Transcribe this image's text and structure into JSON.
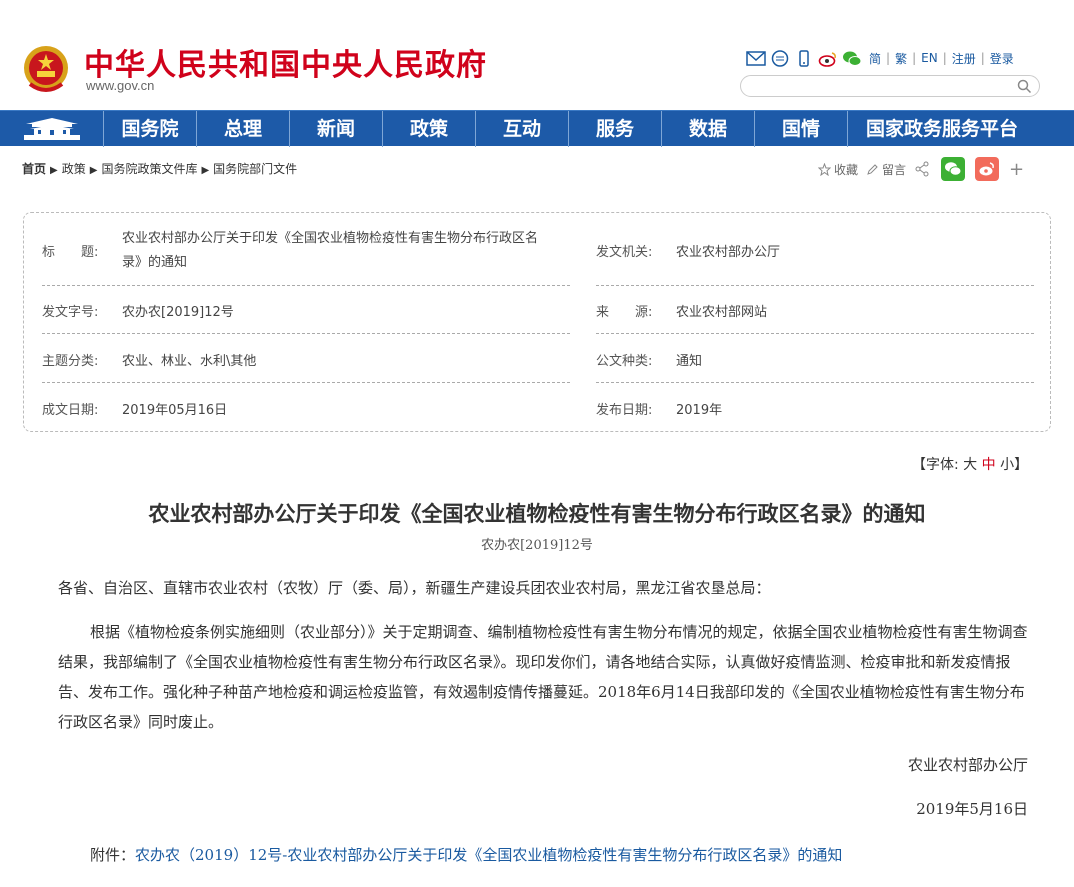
{
  "header": {
    "site_title": "中华人民共和国中央人民政府",
    "site_url": "www.gov.cn",
    "links": [
      "简",
      "繁",
      "EN",
      "注册",
      "登录"
    ],
    "search_placeholder": ""
  },
  "nav": {
    "items": [
      "国务院",
      "总理",
      "新闻",
      "政策",
      "互动",
      "服务",
      "数据",
      "国情",
      "国家政务服务平台"
    ]
  },
  "breadcrumb": {
    "home": "首页",
    "items": [
      "政策",
      "国务院政策文件库",
      "国务院部门文件"
    ],
    "arrow": "▶"
  },
  "tools": {
    "favorite": "收藏",
    "comment": "留言"
  },
  "info": {
    "title_label": "标　　题:",
    "title_value_line1": "农业农村部办公厅关于印发《全国农业植物检疫性有害生物分布行政区名",
    "title_value_line2": "录》的通知",
    "issuer_label": "发文机关:",
    "issuer_value": "农业农村部办公厅",
    "doc_no_label": "发文字号:",
    "doc_no_value": "农办农[2019]12号",
    "source_label": "来　　源:",
    "source_value": "农业农村部网站",
    "topic_label": "主题分类:",
    "topic_value": "农业、林业、水利\\其他",
    "type_label": "公文种类:",
    "type_value": "通知",
    "written_label": "成文日期:",
    "written_value": "2019年05月16日",
    "published_label": "发布日期:",
    "published_value": "2019年"
  },
  "font_ctrl": {
    "prefix": "【字体:",
    "large": "大",
    "medium": "中",
    "small": "小",
    "suffix": "】"
  },
  "document": {
    "title": "农业农村部办公厅关于印发《全国农业植物检疫性有害生物分布行政区名录》的通知",
    "number": "农办农[2019]12号",
    "addressee": "各省、自治区、直辖市农业农村（农牧）厅（委、局），新疆生产建设兵团农业农村局，黑龙江省农垦总局：",
    "body": "根据《植物检疫条例实施细则（农业部分）》关于定期调查、编制植物检疫性有害生物分布情况的规定，依据全国农业植物检疫性有害生物调查结果，我部编制了《全国农业植物检疫性有害生物分布行政区名录》。现印发你们，请各地结合实际，认真做好疫情监测、检疫审批和新发疫情报告、发布工作。强化种子种苗产地检疫和调运检疫监管，有效遏制疫情传播蔓延。2018年6月14日我部印发的《全国农业植物检疫性有害生物分布行政区名录》同时废止。",
    "signature": "农业农村部办公厅",
    "date": "2019年5月16日",
    "attachment_prefix": "附件：",
    "attachment_link": "农办农（2019）12号-农业农村部办公厅关于印发《全国农业植物检疫性有害生物分布行政区名录》的通知"
  },
  "colors": {
    "brand_red": "#d0021b",
    "nav_blue": "#1d5aa8",
    "link_blue": "#1a5aa0",
    "wechat_green": "#3cb034",
    "weibo_orange": "#f26b5b"
  }
}
